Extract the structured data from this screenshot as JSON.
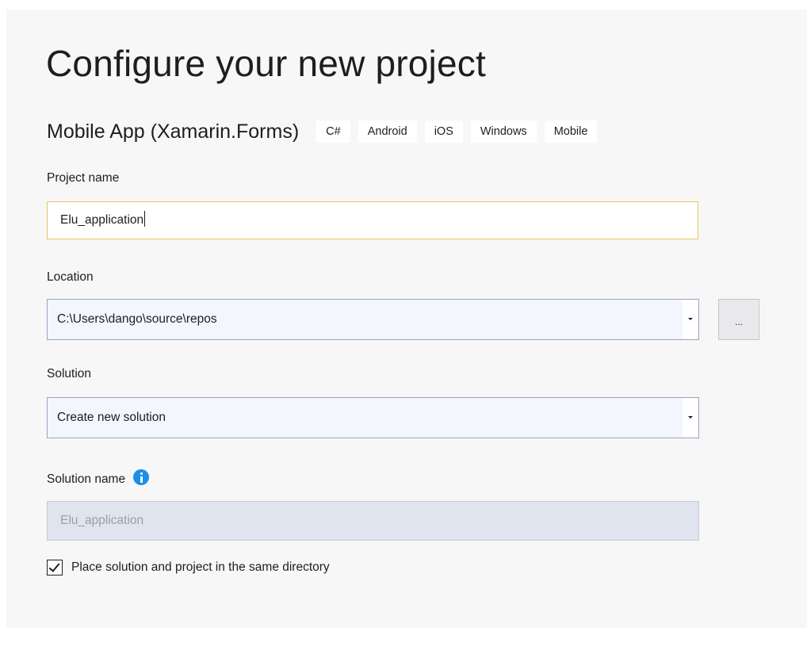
{
  "page": {
    "title": "Configure your new project"
  },
  "template": {
    "name": "Mobile App (Xamarin.Forms)",
    "tags": [
      "C#",
      "Android",
      "iOS",
      "Windows",
      "Mobile"
    ]
  },
  "project_name": {
    "label": "Project name",
    "value": "Elu_application"
  },
  "location": {
    "label": "Location",
    "value": "C:\\Users\\dango\\source\\repos",
    "browse_label": "..."
  },
  "solution": {
    "label": "Solution",
    "value": "Create new solution"
  },
  "solution_name": {
    "label": "Solution name",
    "value": "Elu_application",
    "info_icon": "info-icon",
    "enabled": false
  },
  "same_directory": {
    "label": "Place solution and project in the same directory",
    "checked": true
  },
  "colors": {
    "focus_border": "#e5c365",
    "info_icon": "#1d8ee6",
    "combo_background": "#f3f6fd",
    "combo_border": "#98a3c0"
  }
}
